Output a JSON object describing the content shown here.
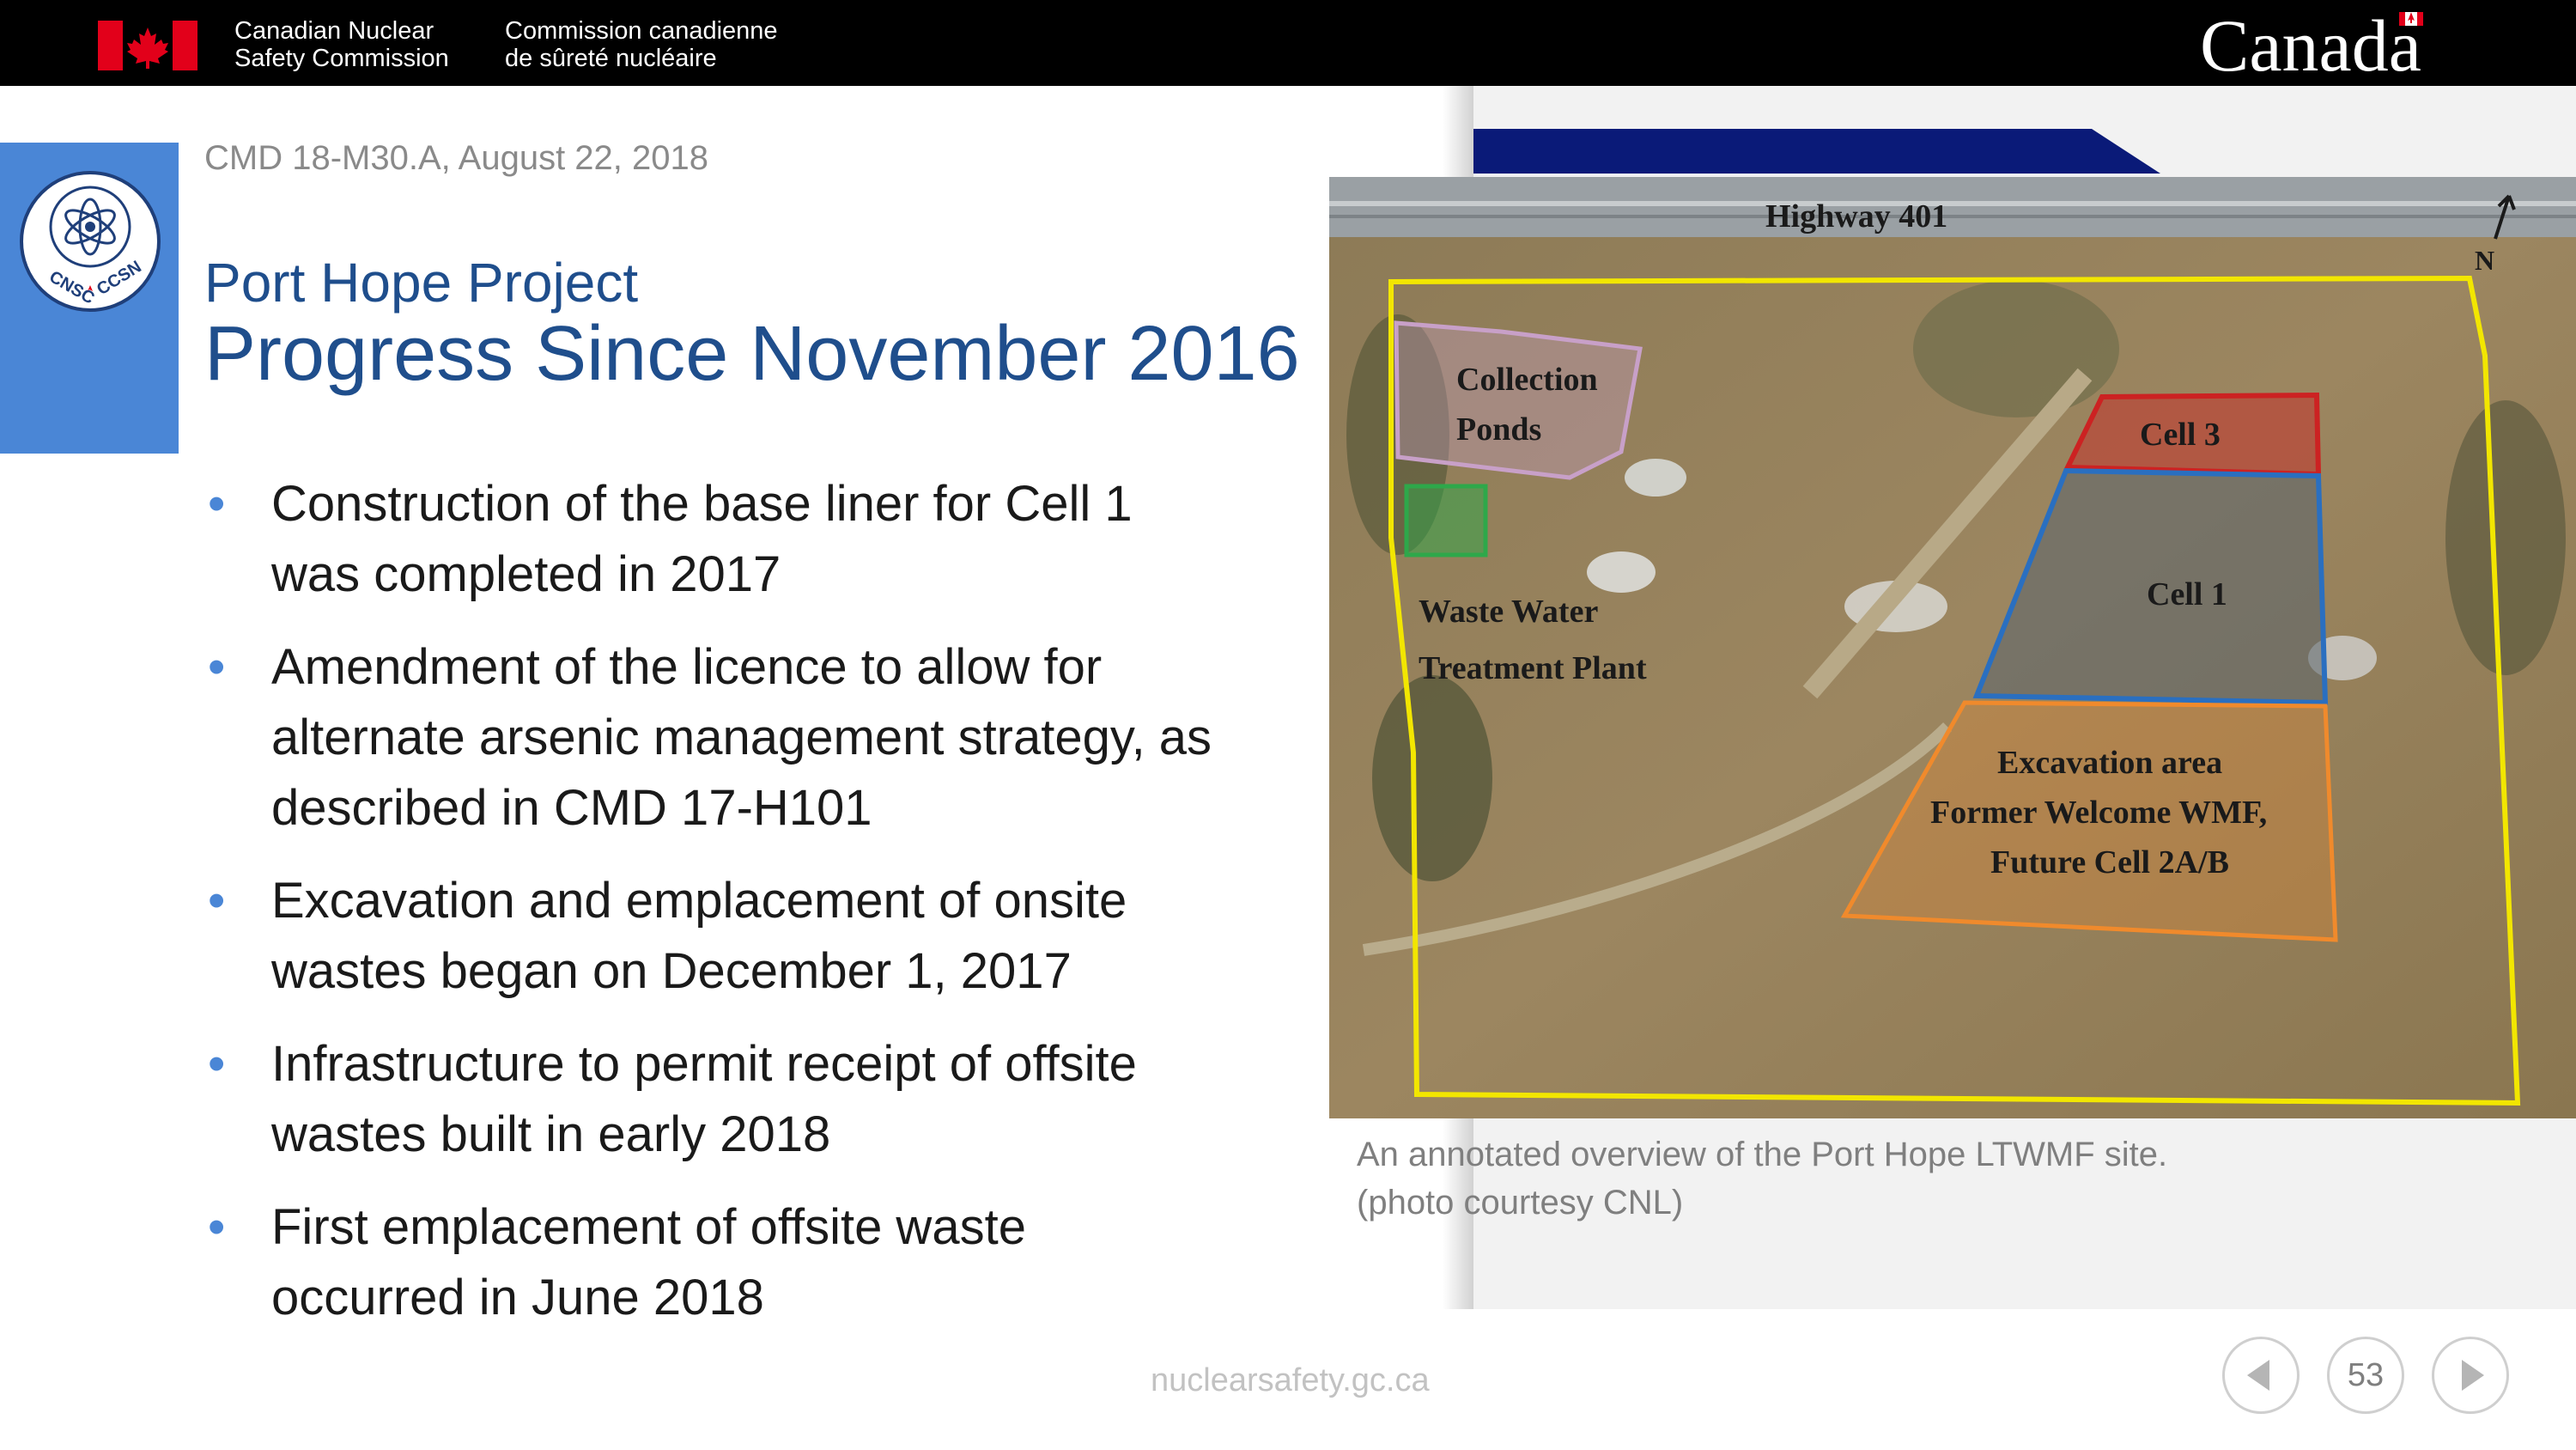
{
  "header": {
    "agency_en_line1": "Canadian Nuclear",
    "agency_en_line2": "Safety Commission",
    "agency_fr_line1": "Commission canadienne",
    "agency_fr_line2": "de sûreté nucléaire",
    "wordmark": "Canada"
  },
  "logo": {
    "text": "CNSC CCSN"
  },
  "slide": {
    "cmd": "CMD 18-M30.A, August 22, 2018",
    "title_line1": "Port Hope Project",
    "title_line2": "Progress Since November 2016",
    "bullets": [
      {
        "line1": "Construction of the base liner for Cell 1",
        "line2": "was completed in 2017",
        "line3": ""
      },
      {
        "line1": "Amendment of the licence to allow for",
        "line2": "alternate arsenic management strategy, as",
        "line3": "described in CMD 17-H101"
      },
      {
        "line1": "Excavation and emplacement of onsite",
        "line2": "wastes began on December 1, 2017",
        "line3": ""
      },
      {
        "line1": "Infrastructure to permit receipt of offsite",
        "line2": "wastes built in early 2018",
        "line3": ""
      },
      {
        "line1": "First emplacement of offsite waste",
        "line2": "occurred in June 2018",
        "line3": ""
      }
    ]
  },
  "photo": {
    "labels": {
      "highway": "Highway 401",
      "north": "N",
      "collection1": "Collection",
      "collection2": "Ponds",
      "cell3": "Cell 3",
      "cell1": "Cell 1",
      "wwtp1": "Waste Water",
      "wwtp2": "Treatment Plant",
      "exc1": "Excavation area",
      "exc2": "Former Welcome WMF,",
      "exc3": "Future Cell 2A/B"
    },
    "caption_line1": "An annotated overview of the Port Hope LTWMF site.",
    "caption_line2": "(photo courtesy CNL)"
  },
  "footer": {
    "url": "nuclearsafety.gc.ca",
    "page_number": "53"
  },
  "colors": {
    "title_blue": "#1f4e8c",
    "accent_blue": "#4a86d6",
    "site_boundary": "#f2e600",
    "cell3_red": "#cc2222",
    "cell1_blue": "#2a6fc0",
    "excavation_orange": "#f08a2c",
    "ponds_lilac": "#c8a0c8",
    "wwtp_green": "#2ea84a"
  }
}
